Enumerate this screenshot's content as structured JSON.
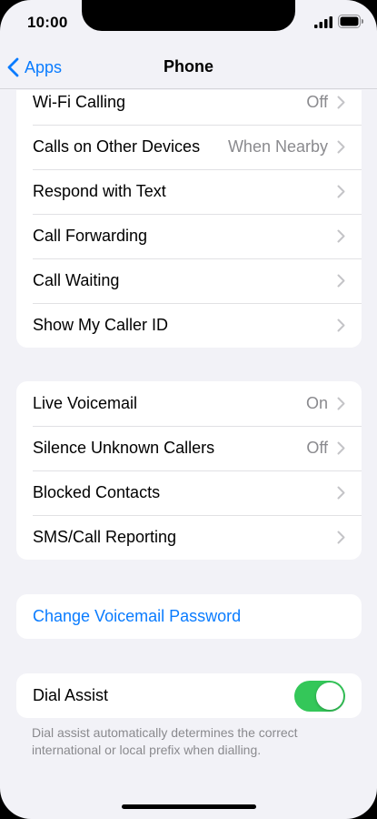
{
  "status_bar": {
    "time": "10:00"
  },
  "nav": {
    "back_label": "Apps",
    "title": "Phone"
  },
  "group1": [
    {
      "label": "Wi-Fi Calling",
      "value": "Off"
    },
    {
      "label": "Calls on Other Devices",
      "value": "When Nearby"
    },
    {
      "label": "Respond with Text",
      "value": ""
    },
    {
      "label": "Call Forwarding",
      "value": ""
    },
    {
      "label": "Call Waiting",
      "value": ""
    },
    {
      "label": "Show My Caller ID",
      "value": ""
    }
  ],
  "group2": [
    {
      "label": "Live Voicemail",
      "value": "On"
    },
    {
      "label": "Silence Unknown Callers",
      "value": "Off"
    },
    {
      "label": "Blocked Contacts",
      "value": ""
    },
    {
      "label": "SMS/Call Reporting",
      "value": ""
    }
  ],
  "voicemail": {
    "change_password_label": "Change Voicemail Password"
  },
  "dial_assist": {
    "label": "Dial Assist",
    "enabled": true,
    "footnote": "Dial assist automatically determines the correct international or local prefix when dialling."
  },
  "colors": {
    "accent": "#0a7cff",
    "toggle_on": "#34c759",
    "background": "#f2f2f7"
  }
}
